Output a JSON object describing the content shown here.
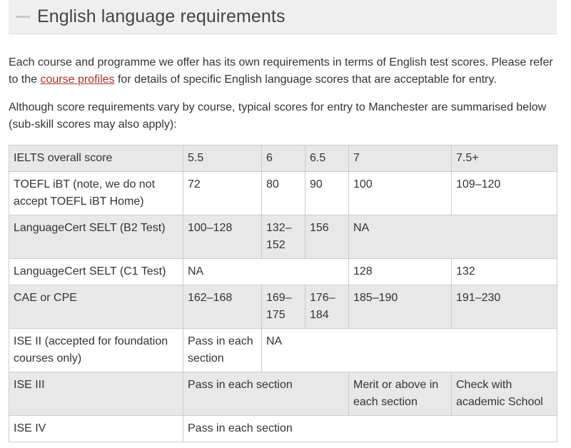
{
  "header": {
    "title": "English language requirements"
  },
  "intro": {
    "p1_before": "Each course and programme we offer has its own requirements in terms of English test scores. Please refer to the ",
    "p1_link": "course profiles",
    "p1_after": " for details of specific English language scores that are acceptable for entry.",
    "p2": "Although score requirements vary by course, typical scores for entry to Manchester are summarised below (sub-skill scores may also apply):"
  },
  "table": {
    "rows": [
      {
        "label": "IELTS overall score",
        "c1": "5.5",
        "c2": "6",
        "c3": "6.5",
        "c4": "7",
        "c5": "7.5+"
      },
      {
        "label": "TOEFL iBT (note, we do not accept TOEFL iBT Home)",
        "c1": "72",
        "c2": "80",
        "c3": "90",
        "c4": "100",
        "c5": "109–120"
      },
      {
        "label": "LanguageCert SELT (B2 Test)",
        "c1": "100–128",
        "c2": "132–152",
        "c3": "156",
        "c4": "NA"
      },
      {
        "label": "LanguageCert SELT (C1 Test)",
        "c1": "NA",
        "c4": "128",
        "c5": "132"
      },
      {
        "label": "CAE or CPE",
        "c1": "162–168",
        "c2": "169–175",
        "c3": "176–184",
        "c4": "185–190",
        "c5": "191–230"
      },
      {
        "label": "ISE II (accepted for foundation courses only)",
        "c1": "Pass in each section",
        "c2": "NA"
      },
      {
        "label": "ISE III",
        "c1": "Pass in each section",
        "c4": "Merit or above in each section",
        "c5": "Check with academic School"
      },
      {
        "label": "ISE IV",
        "c1": "Pass in each section"
      }
    ]
  }
}
